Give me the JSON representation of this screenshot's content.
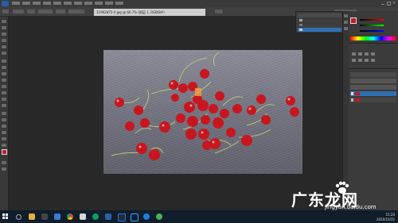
{
  "document": {
    "tab_label": "11962875-4.jpg @ 66.7% (图层 1, RGB/8#)"
  },
  "menu": {
    "items": [
      "",
      "",
      "",
      "",
      "",
      "",
      "",
      "",
      "",
      "",
      ""
    ]
  },
  "clock": {
    "time": "15:20",
    "date": "2020/10/31"
  },
  "watermark": {
    "main": "广东龙网",
    "sub": "jingyan.baidu.com"
  },
  "colors": {
    "foreground": "#c41b2a",
    "background": "#ffffff",
    "taskbar": "#101d2b"
  },
  "taskbar": {
    "icons": [
      "search-icon",
      "task-view-icon",
      "file-explorer-icon",
      "chrome-icon",
      "edge-icon",
      "store-icon",
      "photoshop-icon",
      "app-icon",
      "app-icon-2"
    ]
  }
}
